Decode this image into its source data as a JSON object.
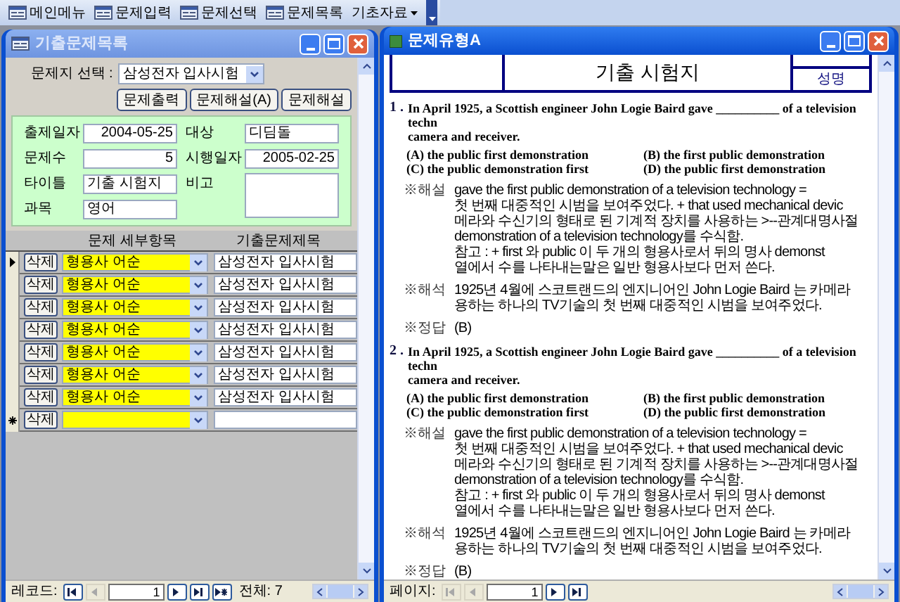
{
  "toolbar": {
    "items": [
      {
        "label": "메인메뉴",
        "kind": "form"
      },
      {
        "label": "문제입력",
        "kind": "form"
      },
      {
        "label": "문제선택",
        "kind": "form"
      },
      {
        "label": "문제목록",
        "kind": "form"
      },
      {
        "label": "기초자료",
        "kind": "menu"
      }
    ]
  },
  "list_window": {
    "title": "기출문제목록",
    "active": false,
    "selector": {
      "label": "문제지 선택 :",
      "value": "삼성전자 입사시험"
    },
    "buttons": [
      "문제출력",
      "문제해설(A)",
      "문제해설"
    ],
    "fields": [
      {
        "label": "출제일자",
        "value": "2004-05-25",
        "kind": "date"
      },
      {
        "label": "대상",
        "value": "디딤돌",
        "kind": "text"
      },
      {
        "label": "문제수",
        "value": "5",
        "kind": "number"
      },
      {
        "label": "시행일자",
        "value": "2005-02-25",
        "kind": "date"
      },
      {
        "label": "타이틀",
        "value": "기출 시험지",
        "kind": "text"
      },
      {
        "label": "비고",
        "kind": "memo"
      },
      {
        "label": "과목",
        "value": "영어",
        "kind": "text"
      }
    ],
    "columns": [
      "문제 세부항목",
      "기출문제제목"
    ],
    "rows": [
      {
        "kind": "current",
        "delete": "삭제",
        "detail": "형용사 어순",
        "title": "삼성전자 입사시험"
      },
      {
        "kind": "record",
        "delete": "삭제",
        "detail": "형용사 어순",
        "title": "삼성전자 입사시험"
      },
      {
        "kind": "record",
        "delete": "삭제",
        "detail": "형용사 어순",
        "title": "삼성전자 입사시험"
      },
      {
        "kind": "record",
        "delete": "삭제",
        "detail": "형용사 어순",
        "title": "삼성전자 입사시험"
      },
      {
        "kind": "record",
        "delete": "삭제",
        "detail": "형용사 어순",
        "title": "삼성전자 입사시험"
      },
      {
        "kind": "record",
        "delete": "삭제",
        "detail": "형용사 어순",
        "title": "삼성전자 입사시험"
      },
      {
        "kind": "record",
        "delete": "삭제",
        "detail": "형용사 어순",
        "title": "삼성전자 입사시험"
      },
      {
        "kind": "new",
        "delete": "삭제"
      }
    ],
    "navigator": {
      "label": "레코드:",
      "current": "1",
      "total": "전체: 7",
      "buttons": [
        {
          "kind": "first",
          "disabled": false
        },
        {
          "kind": "prev",
          "disabled": true
        },
        {
          "kind": "next",
          "disabled": false
        },
        {
          "kind": "last",
          "disabled": false
        },
        {
          "kind": "new",
          "disabled": false
        }
      ]
    }
  },
  "doc_window": {
    "title": "문제유형A",
    "active": true,
    "header": {
      "title": "기출 시험지",
      "cell": "성명"
    },
    "questions": [
      {
        "number": "1 .",
        "stem": [
          "In April 1925, a Scottish engineer John Logie Baird gave __________ of a television techn",
          "camera and receiver."
        ],
        "options": [
          "(A) the public first demonstration",
          "(B) the first public demonstration",
          "(C)  the public demonstration first",
          "(D) the public first demonstration"
        ],
        "sections": [
          {
            "label": "※해설",
            "lines": [
              "gave the first public demonstration of a television technology =",
              "첫 번째 대중적인 시범을 보여주었다. + that used mechanical devic",
              "메라와 수신기의 형태로 된 기계적 장치를 사용하는 >--관계대명사절",
              "demonstration of a television technology를 수식함.",
              "참고 : + first 와 public 이 두 개의 형용사로서 뒤의 명사 demonst",
              "열에서 수를 나타내는말은 일반 형용사보다 먼저 쓴다."
            ]
          },
          {
            "label": "※해석",
            "lines": [
              "1925년 4월에 스코트랜드의 엔지니어인 John Logie Baird 는 카메라",
              "용하는 하나의 TV기술의 첫 번째 대중적인 시범을 보여주었다."
            ]
          },
          {
            "label": "※정답",
            "lines": [
              "(B)"
            ]
          }
        ]
      },
      {
        "number": "2 .",
        "stem": [
          "In April 1925, a Scottish engineer John Logie Baird gave __________ of a television techn",
          "camera and receiver."
        ],
        "options": [
          "(A) the public first demonstration",
          "(B) the first public demonstration",
          "(C)  the public demonstration first",
          "(D) the public first demonstration"
        ],
        "sections": [
          {
            "label": "※해설",
            "lines": [
              "gave the first public demonstration of a television technology =",
              "첫 번째 대중적인 시범을 보여주었다. + that used mechanical devic",
              "메라와 수신기의 형태로 된 기계적 장치를 사용하는 >--관계대명사절",
              "demonstration of a television technology를 수식함.",
              "참고 : + first 와 public 이 두 개의 형용사로서 뒤의 명사 demonst",
              "열에서 수를 나타내는말은 일반 형용사보다 먼저 쓴다."
            ]
          },
          {
            "label": "※해석",
            "lines": [
              "1925년 4월에 스코트랜드의 엔지니어인 John Logie Baird 는 카메라",
              "용하는 하나의 TV기술의 첫 번째 대중적인 시범을 보여주었다."
            ]
          },
          {
            "label": "※정답",
            "lines": [
              "(B)"
            ]
          }
        ]
      }
    ],
    "navigator": {
      "label": "페이지:",
      "current": "1",
      "buttons": [
        {
          "kind": "first",
          "disabled": true
        },
        {
          "kind": "prev",
          "disabled": true
        },
        {
          "kind": "next",
          "disabled": false
        },
        {
          "kind": "last",
          "disabled": false
        }
      ]
    }
  }
}
